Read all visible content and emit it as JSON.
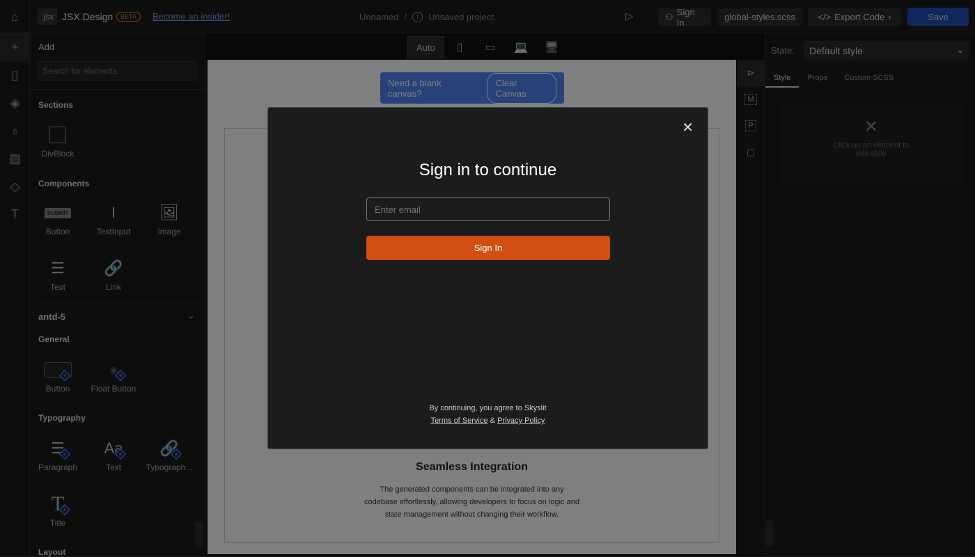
{
  "topbar": {
    "logo_badge": ".jsx",
    "app_name": "JSX.Design",
    "beta": "BETA",
    "insider_link": "Become an insider!",
    "project_name": "Unnamed",
    "separator": "/",
    "project_status": "Unsaved project.",
    "sign_in": "Sign In",
    "styles_file": "global-styles.scss",
    "export": "Export Code",
    "save": "Save"
  },
  "left": {
    "add_title": "Add",
    "search_placeholder": "Search for elements",
    "sections_title": "Sections",
    "sections": [
      {
        "label": "DivBlock",
        "icon": "square-icon"
      }
    ],
    "components_title": "Components",
    "components": [
      {
        "label": "Button",
        "icon": "submit-button-icon"
      },
      {
        "label": "TextInput",
        "icon": "text-cursor-icon"
      },
      {
        "label": "Image",
        "icon": "image-icon"
      },
      {
        "label": "Text",
        "icon": "text-lines-icon"
      },
      {
        "label": "Link",
        "icon": "link-icon"
      }
    ],
    "library": "antd-5",
    "general_title": "General",
    "general": [
      {
        "label": "Button"
      },
      {
        "label": "Float Button"
      }
    ],
    "typography_title": "Typography",
    "typography": [
      {
        "label": "Paragraph"
      },
      {
        "label": "Text"
      },
      {
        "label": "Typograph..."
      },
      {
        "label": "Title"
      }
    ],
    "layout_title": "Layout",
    "submit_glyph": "SUBMIT"
  },
  "devices": {
    "auto": "Auto"
  },
  "canvas": {
    "banner_text": "Need a blank canvas?",
    "clear_button": "Clear Canvas",
    "feature_title": "Seamless Integration",
    "feature_body": "The generated components can be integrated into any codebase effortlessly, allowing developers to focus on logic and state management without changing their workflow."
  },
  "tools": {
    "m": "M",
    "p": "P"
  },
  "right": {
    "state_label": "State:",
    "state_value": "Default style",
    "tabs": [
      "Style",
      "Props",
      "Custom SCSS"
    ],
    "empty_hint": "Click on an element to edit style"
  },
  "modal": {
    "title": "Sign in to continue",
    "email_placeholder": "Enter email",
    "submit": "Sign In",
    "agree": "By continuing, you agree to Skyslit",
    "terms": "Terms of Service",
    "amp": "&",
    "privacy": "Privacy Policy"
  },
  "colors": {
    "accent": "#1e4fb8",
    "signin": "#d04e14",
    "banner": "#3a6fd8"
  }
}
